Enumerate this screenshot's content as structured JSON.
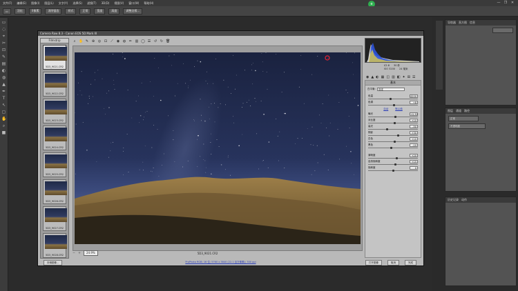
{
  "app": {
    "menu": [
      "文件(F)",
      "编辑(E)",
      "图像(I)",
      "图层(L)",
      "文字(Y)",
      "选择(S)",
      "滤镜(T)",
      "3D(D)",
      "视图(V)",
      "窗口(W)",
      "帮助(H)"
    ],
    "options": [
      "羽化",
      "0像素",
      "消除锯齿",
      "样式",
      "正常",
      "宽度",
      "高度",
      "调整边缘..."
    ],
    "badge": "e",
    "window_controls": [
      "—",
      "❐",
      "✕"
    ]
  },
  "right_panels": {
    "top": {
      "tabs": [
        "导航器",
        "直方图",
        "信息"
      ],
      "button": ""
    },
    "middle": {
      "tabs": [
        "图层",
        "通道",
        "路径"
      ],
      "row1": "正常",
      "row2": "不透明度"
    },
    "bottom": {
      "tabs": [
        "历史记录",
        "动作"
      ]
    }
  },
  "camera_raw": {
    "title": "Camera Raw 8.3 - Canon EOS 5D Mark III",
    "filmstrip_header": "Filmstrip",
    "thumbnails": [
      {
        "caption": "5D3_9021.CR2",
        "selected": true
      },
      {
        "caption": "5D3_9022.CR2",
        "selected": false
      },
      {
        "caption": "5D3_9023.CR2",
        "selected": false
      },
      {
        "caption": "5D3_9024.CR2",
        "selected": false
      },
      {
        "caption": "5D3_9025.CR2",
        "selected": false
      },
      {
        "caption": "5D3_9026.CR2",
        "selected": false
      },
      {
        "caption": "5D3_9027.CR2",
        "selected": false
      },
      {
        "caption": "5D3_9028.CR2",
        "selected": false
      }
    ],
    "toolbar_icons": [
      "zoom-icon",
      "hand-icon",
      "white-balance-icon",
      "color-sampler-icon",
      "target-adjust-icon",
      "crop-icon",
      "straighten-icon",
      "spot-removal-icon",
      "red-eye-icon",
      "adjustment-brush-icon",
      "graduated-filter-icon",
      "radial-filter-icon",
      "preferences-icon",
      "rotate-left-icon",
      "rotate-right-icon",
      "trash-icon"
    ],
    "preview_filename": "5D3_9021.CR2",
    "zoom": "24.9%",
    "exif": {
      "aperture": "f/2.8",
      "shutter": "30 秒",
      "iso": "ISO 3200",
      "focal": "24 毫米"
    },
    "panel_title": "基本",
    "white_balance_label": "白平衡:",
    "white_balance_value": "自定",
    "auto_label": "自动",
    "default_label": "默认值",
    "wb_sliders": [
      {
        "label": "色温",
        "value": "4200",
        "pos": 0.45
      },
      {
        "label": "色调",
        "value": "+8",
        "pos": 0.52
      }
    ],
    "tone_sliders": [
      {
        "label": "曝光",
        "value": "+0.30",
        "pos": 0.55
      },
      {
        "label": "对比度",
        "value": "+10",
        "pos": 0.53
      },
      {
        "label": "高光",
        "value": "-50",
        "pos": 0.38
      },
      {
        "label": "阴影",
        "value": "+30",
        "pos": 0.6
      },
      {
        "label": "白色",
        "value": "+10",
        "pos": 0.53
      },
      {
        "label": "黑色",
        "value": "-10",
        "pos": 0.47
      }
    ],
    "presence_sliders": [
      {
        "label": "清晰度",
        "value": "+20",
        "pos": 0.57
      },
      {
        "label": "自然饱和度",
        "value": "+15",
        "pos": 0.55
      },
      {
        "label": "饱和度",
        "value": "0",
        "pos": 0.5
      }
    ],
    "bottom": {
      "save_button": "存储图像...",
      "workflow_link": "ProPhoto RGB; 16 位; 5760 x 3840 (22.1 百万像素); 300 ppi",
      "open_button": "打开图像",
      "cancel_button": "取消",
      "done_button": "完成"
    },
    "colors": {
      "sky_top": "#1c2546",
      "sky_bottom": "#3a4a7a",
      "sand": "#8a7040",
      "shadow": "#2a2418"
    }
  }
}
